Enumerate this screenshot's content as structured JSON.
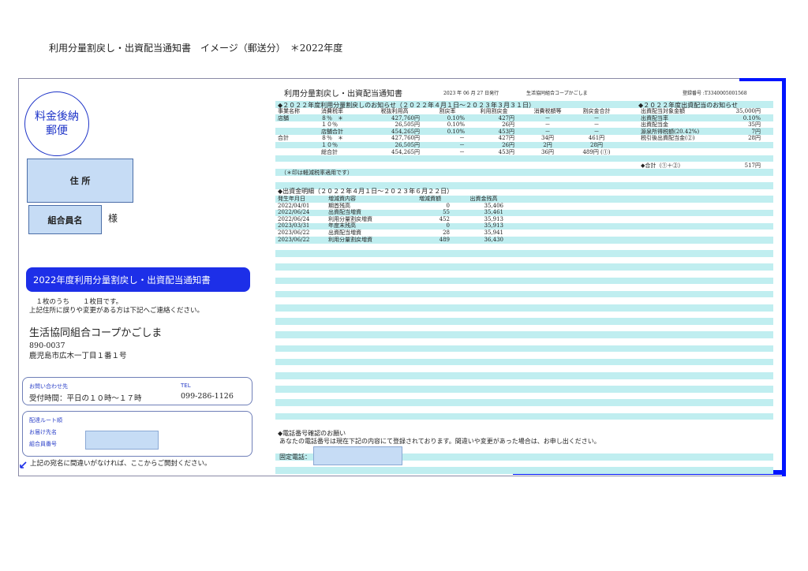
{
  "page_heading": "利用分量割戻し・出資配当通知書　イメージ（郵送分）　＊2022年度",
  "mailer": {
    "stamp_line1": "料金後納",
    "stamp_line2": "郵便",
    "address_label": "住 所",
    "member_name_label": "組合員名",
    "honorific": "様",
    "banner": "2022年度利用分量割戻し・出資配当通知書",
    "page_count": "　１枚のうち　　１枚目です。",
    "notice": "上記住所に誤りや変更がある方は下記へご連絡ください。",
    "coop_name": "生活協同組合コープかごしま",
    "postal_code": "890-0037",
    "address": "鹿児島市広木一丁目１番１号",
    "contact_label": "お問い合わせ先",
    "tel_label": "TEL",
    "hours": "受付時間：平日の１０時～１７時",
    "tel": "099-286-1126",
    "route_label": "配達ルート順",
    "recipient_label": "お届け先名",
    "member_number_label": "組合員番号",
    "open_note": "上記の宛名に間違いがなければ、ここからご開封ください。"
  },
  "header": {
    "title": "利用分量割戻し・出資配当通知書",
    "issue_date": "2023 年 06 月 27 日発行",
    "issuer": "生活協同組合コープかごしま",
    "registration": "登録番号 :T3340005001568"
  },
  "rebate": {
    "section_title": "◆２０２２年度利用分量割戻しのお知らせ（２０２２年４月１日～２０２３年３月３１日）",
    "headers": [
      "事業名称",
      "消費税率",
      "税抜利用高",
      "割戻率",
      "利用割戻金",
      "消費税額等",
      "割戻金合計"
    ],
    "rows": [
      [
        "店舗",
        "８％　＊",
        "427,760円",
        "0.10%",
        "427円",
        "－",
        "－"
      ],
      [
        "",
        "１０％",
        "26,505円",
        "0.10%",
        "26円",
        "－",
        "－"
      ],
      [
        "",
        "店舗合計",
        "454,265円",
        "0.10%",
        "453円",
        "－",
        "－"
      ],
      [
        "合計",
        "８％　＊",
        "427,760円",
        "－",
        "427円",
        "34円",
        "461円"
      ],
      [
        "",
        "１０％",
        "26,505円",
        "－",
        "26円",
        "2円",
        "28円"
      ],
      [
        "",
        "総合計",
        "454,265円",
        "－",
        "453円",
        "36円",
        "489円 (①)"
      ]
    ],
    "footnote": "（＊印は軽減税率適用です）"
  },
  "dividend": {
    "section_title": "◆２０２２年度出資配当のお知らせ",
    "rows": [
      [
        "出資配当対象金額",
        "35,000円"
      ],
      [
        "出資配当率",
        "0.10%"
      ],
      [
        "出資配当金",
        "35円"
      ],
      [
        "源泉所得税額(20.42%)",
        "7円"
      ],
      [
        "税引後出資配当金(②)",
        "28円"
      ]
    ],
    "total_label": "◆合計（①＋②）",
    "total_value": "517円"
  },
  "ledger": {
    "section_title": "◆出資金明細（２０２２年４月１日～２０２３年６月２２日）",
    "headers": [
      "発生年月日",
      "増減資内容",
      "増減資額",
      "出資金残高"
    ],
    "rows": [
      [
        "2022/04/01",
        "期首残高",
        "0",
        "35,406"
      ],
      [
        "2022/06/24",
        "出資配当増資",
        "55",
        "35,461"
      ],
      [
        "2022/06/24",
        "利用分量割戻増資",
        "452",
        "35,913"
      ],
      [
        "2023/03/31",
        "年度末残高",
        "0",
        "35,913"
      ],
      [
        "2023/06/22",
        "出資配当増資",
        "28",
        "35,941"
      ],
      [
        "2023/06/22",
        "利用分量割戻増資",
        "489",
        "36,430"
      ]
    ]
  },
  "phone": {
    "section_title": "◆電話番号確認のお願い",
    "note": "あなたの電話番号は現在下記の内容にて登録されております。間違いや変更があった場合は、お申し出ください。",
    "label": "固定電話："
  },
  "colors": {
    "accent_blue": "#1d2fe8",
    "field_blue": "#c6dcf5",
    "stripe": "#c0eef0"
  }
}
